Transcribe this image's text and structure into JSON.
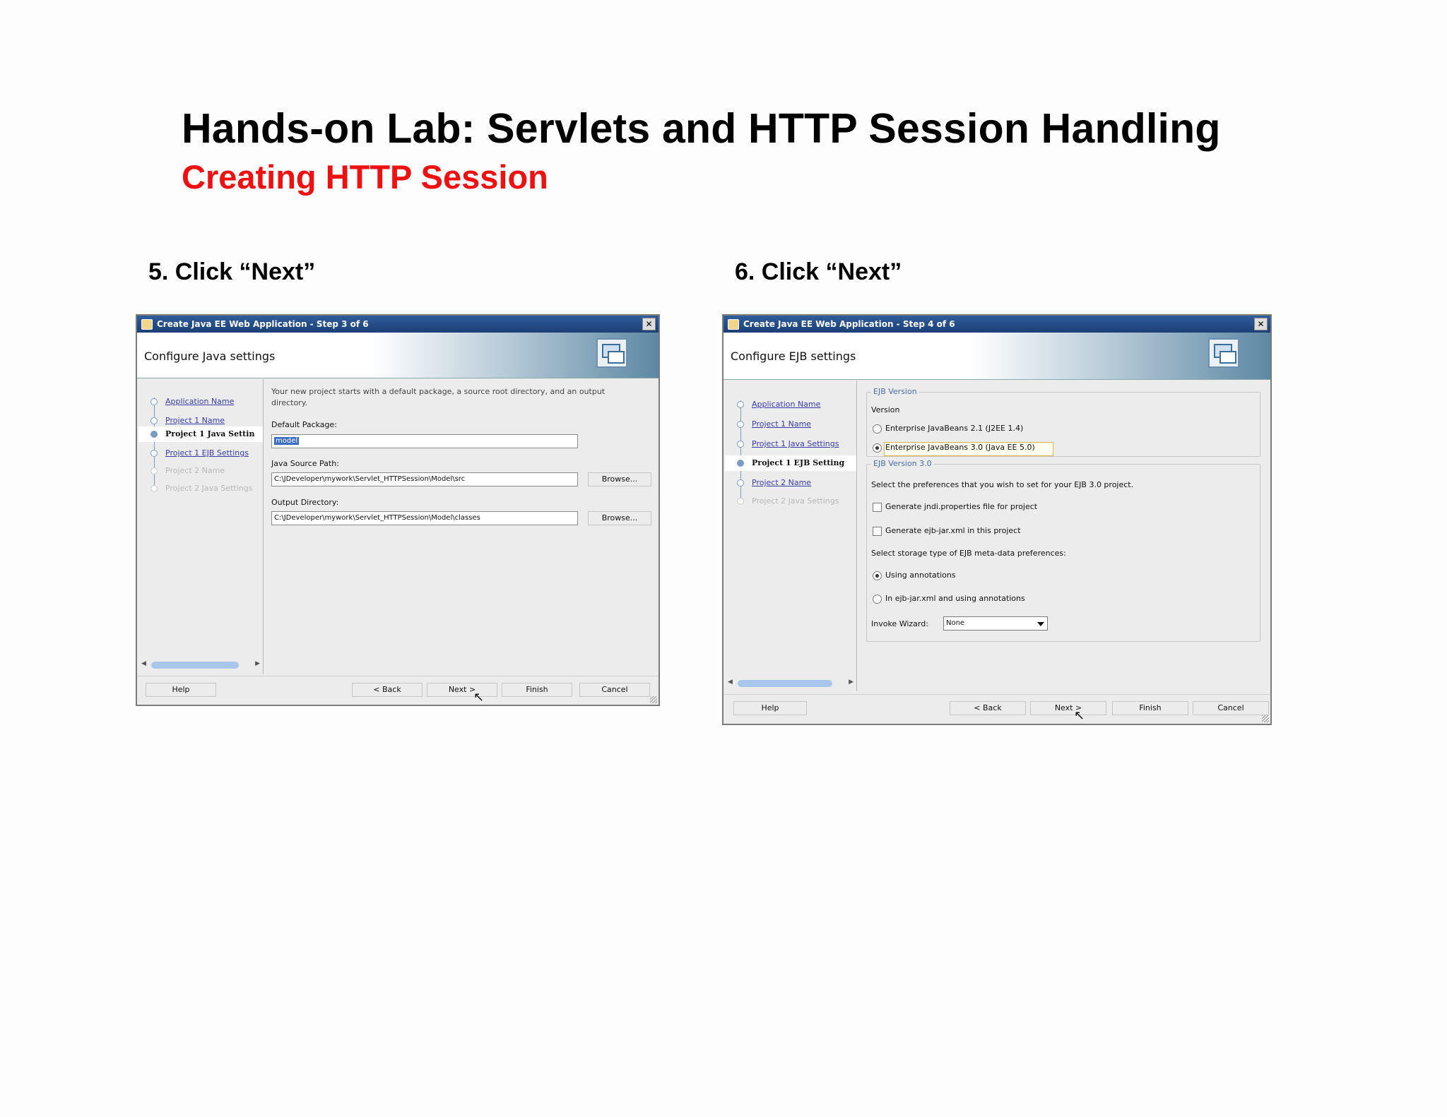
{
  "slide": {
    "title": "Hands-on Lab: Servlets and HTTP Session Handling",
    "subtitle": "Creating HTTP Session"
  },
  "steps": {
    "step5_label": "5. Click “Next”",
    "step6_label": "6. Click “Next”"
  },
  "dialog1": {
    "window_title": "Create Java EE Web Application - Step 3 of 6",
    "banner_title": "Configure Java settings",
    "nav": [
      "Application Name",
      "Project 1 Name",
      "Project 1 Java Settin",
      "Project 1 EJB Settings",
      "Project 2 Name",
      "Project 2 Java Settings"
    ],
    "description": "Your new project starts with a default package, a source root directory, and an output directory.",
    "default_package_label": "Default Package:",
    "default_package_value": "model",
    "java_source_path_label": "Java Source Path:",
    "java_source_path_value": "C:\\JDeveloper\\mywork\\Servlet_HTTPSession\\Model\\src",
    "output_directory_label": "Output Directory:",
    "output_directory_value": "C:\\JDeveloper\\mywork\\Servlet_HTTPSession\\Model\\classes",
    "browse_label": "Browse...",
    "buttons": {
      "help": "Help",
      "back": "< Back",
      "next": "Next >",
      "finish": "Finish",
      "cancel": "Cancel"
    }
  },
  "dialog2": {
    "window_title": "Create Java EE Web Application - Step 4 of 6",
    "banner_title": "Configure EJB settings",
    "nav": [
      "Application Name",
      "Project 1 Name",
      "Project 1 Java Settings",
      "Project 1 EJB Setting",
      "Project 2 Name",
      "Project 2 Java Settings"
    ],
    "ejb_version_group": "EJB Version",
    "version_label": "Version",
    "option_ejb21": "Enterprise JavaBeans 2.1 (J2EE 1.4)",
    "option_ejb30": "Enterprise JavaBeans 3.0 (Java EE 5.0)",
    "ejb30_group": "EJB Version 3.0",
    "preferences_text": "Select the preferences that you wish to set for your EJB 3.0 project.",
    "generate_jndi": "Generate jndi.properties file for project",
    "generate_ejbjar": "Generate ejb-jar.xml in this project",
    "storage_text": "Select storage type of EJB meta-data preferences:",
    "option_annotations": "Using annotations",
    "option_ejbjar_annotations": "In ejb-jar.xml and using annotations",
    "invoke_wizard_label": "Invoke Wizard:",
    "invoke_wizard_value": "None",
    "buttons": {
      "help": "Help",
      "back": "< Back",
      "next": "Next >",
      "finish": "Finish",
      "cancel": "Cancel"
    }
  }
}
